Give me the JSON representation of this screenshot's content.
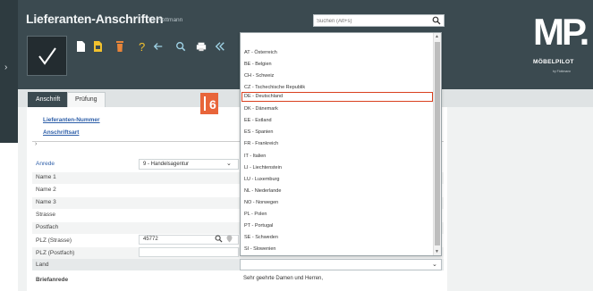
{
  "header": {
    "title": "Lieferanten-Anschriften",
    "user": "Uli Flottmann",
    "search_placeholder": "Suchen (Alt+s)"
  },
  "logo": {
    "mark": "MP.",
    "name": "MÖBELPILOT",
    "tagline": "by Flottmann"
  },
  "tabs": [
    {
      "label": "Anschrift",
      "active": true
    },
    {
      "label": "Prüfung",
      "active": false
    }
  ],
  "links": [
    "Lieferanten-Nummer",
    "Anschriftsart"
  ],
  "form": {
    "anrede_label": "Anrede",
    "anrede_value": "9 - Handelsagentur",
    "name1": "Name 1",
    "name2": "Name 2",
    "name3": "Name 3",
    "strasse": "Strasse",
    "postfach": "Postfach",
    "plz_strasse": "PLZ (Strasse)",
    "plz_strasse_value": "45772",
    "plz_postfach": "PLZ (Postfach)",
    "land": "Land",
    "briefanrede": "Briefanrede",
    "briefanrede_value": "Sehr geehrte Damen und Herren,"
  },
  "dropdown": {
    "highlighted": "DE - Deutschland",
    "items": [
      "AT - Österreich",
      "BE - Belgien",
      "CH - Schweiz",
      "CZ - Tschechische Republik",
      "DE - Deutschland",
      "DK - Dänemark",
      "EE - Estland",
      "ES - Spanien",
      "FR - Frankreich",
      "IT - Italien",
      "LI - Liechtenstein",
      "LU - Luxemburg",
      "NL - Niederlande",
      "NO - Norwegen",
      "PL - Polen",
      "PT - Portugal",
      "SE - Schweden",
      "SI - Slowenien"
    ]
  },
  "marker": {
    "number": "6"
  },
  "colors": {
    "header_bg": "#3b4a50",
    "accent_orange": "#e8653a",
    "link_blue": "#2d5ea8"
  }
}
